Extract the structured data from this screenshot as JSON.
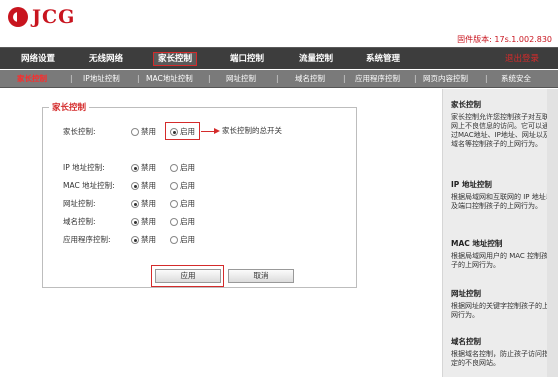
{
  "header": {
    "brand": "JCG",
    "firmware": "固件版本: 17s.1.002.830"
  },
  "nav": {
    "items": [
      {
        "label": "网络设置"
      },
      {
        "label": "无线网络"
      },
      {
        "label": "家长控制"
      },
      {
        "label": "端口控制"
      },
      {
        "label": "流量控制"
      },
      {
        "label": "系统管理"
      }
    ],
    "logout": "退出登录"
  },
  "subnav": {
    "items": [
      {
        "label": "家长控制"
      },
      {
        "label": "IP地址控制"
      },
      {
        "label": "MAC地址控制"
      },
      {
        "label": "网址控制"
      },
      {
        "label": "域名控制"
      },
      {
        "label": "应用程序控制"
      },
      {
        "label": "网页内容控制"
      },
      {
        "label": "系统安全"
      }
    ],
    "separator": "|"
  },
  "panel": {
    "title": "家长控制",
    "master": {
      "label": "家长控制:",
      "off": "禁用",
      "on": "启用",
      "selected": "on"
    },
    "annotation": "家长控制的总开关",
    "rows": [
      {
        "label": "IP 地址控制:",
        "off": "禁用",
        "on": "启用",
        "selected": "off"
      },
      {
        "label": "MAC 地址控制:",
        "off": "禁用",
        "on": "启用",
        "selected": "off"
      },
      {
        "label": "网址控制:",
        "off": "禁用",
        "on": "启用",
        "selected": "off"
      },
      {
        "label": "域名控制:",
        "off": "禁用",
        "on": "启用",
        "selected": "off"
      },
      {
        "label": "应用程序控制:",
        "off": "禁用",
        "on": "启用",
        "selected": "off"
      }
    ],
    "apply": "应用",
    "cancel": "取消"
  },
  "help": [
    {
      "title": "家长控制",
      "text": "家长控制允许您控制孩子对互联网上不良信息的访问。它可以通过MAC地址、IP地址、网址以及域名等控制孩子的上网行为。"
    },
    {
      "title": "IP 地址控制",
      "text": "根据局域网和互联网的 IP 地址以及端口控制孩子的上网行为。"
    },
    {
      "title": "MAC 地址控制",
      "text": "根据局域网用户的 MAC 控制孩子的上网行为。"
    },
    {
      "title": "网址控制",
      "text": "根据网址的关键字控制孩子的上网行为。"
    },
    {
      "title": "域名控制",
      "text": "根据域名控制，防止孩子访问指定的不良网站。"
    }
  ],
  "colors": {
    "accent": "#d42b2b",
    "nav": "#3d3d3d",
    "subnav": "#7a7a7a",
    "help_bg": "#ececec"
  }
}
